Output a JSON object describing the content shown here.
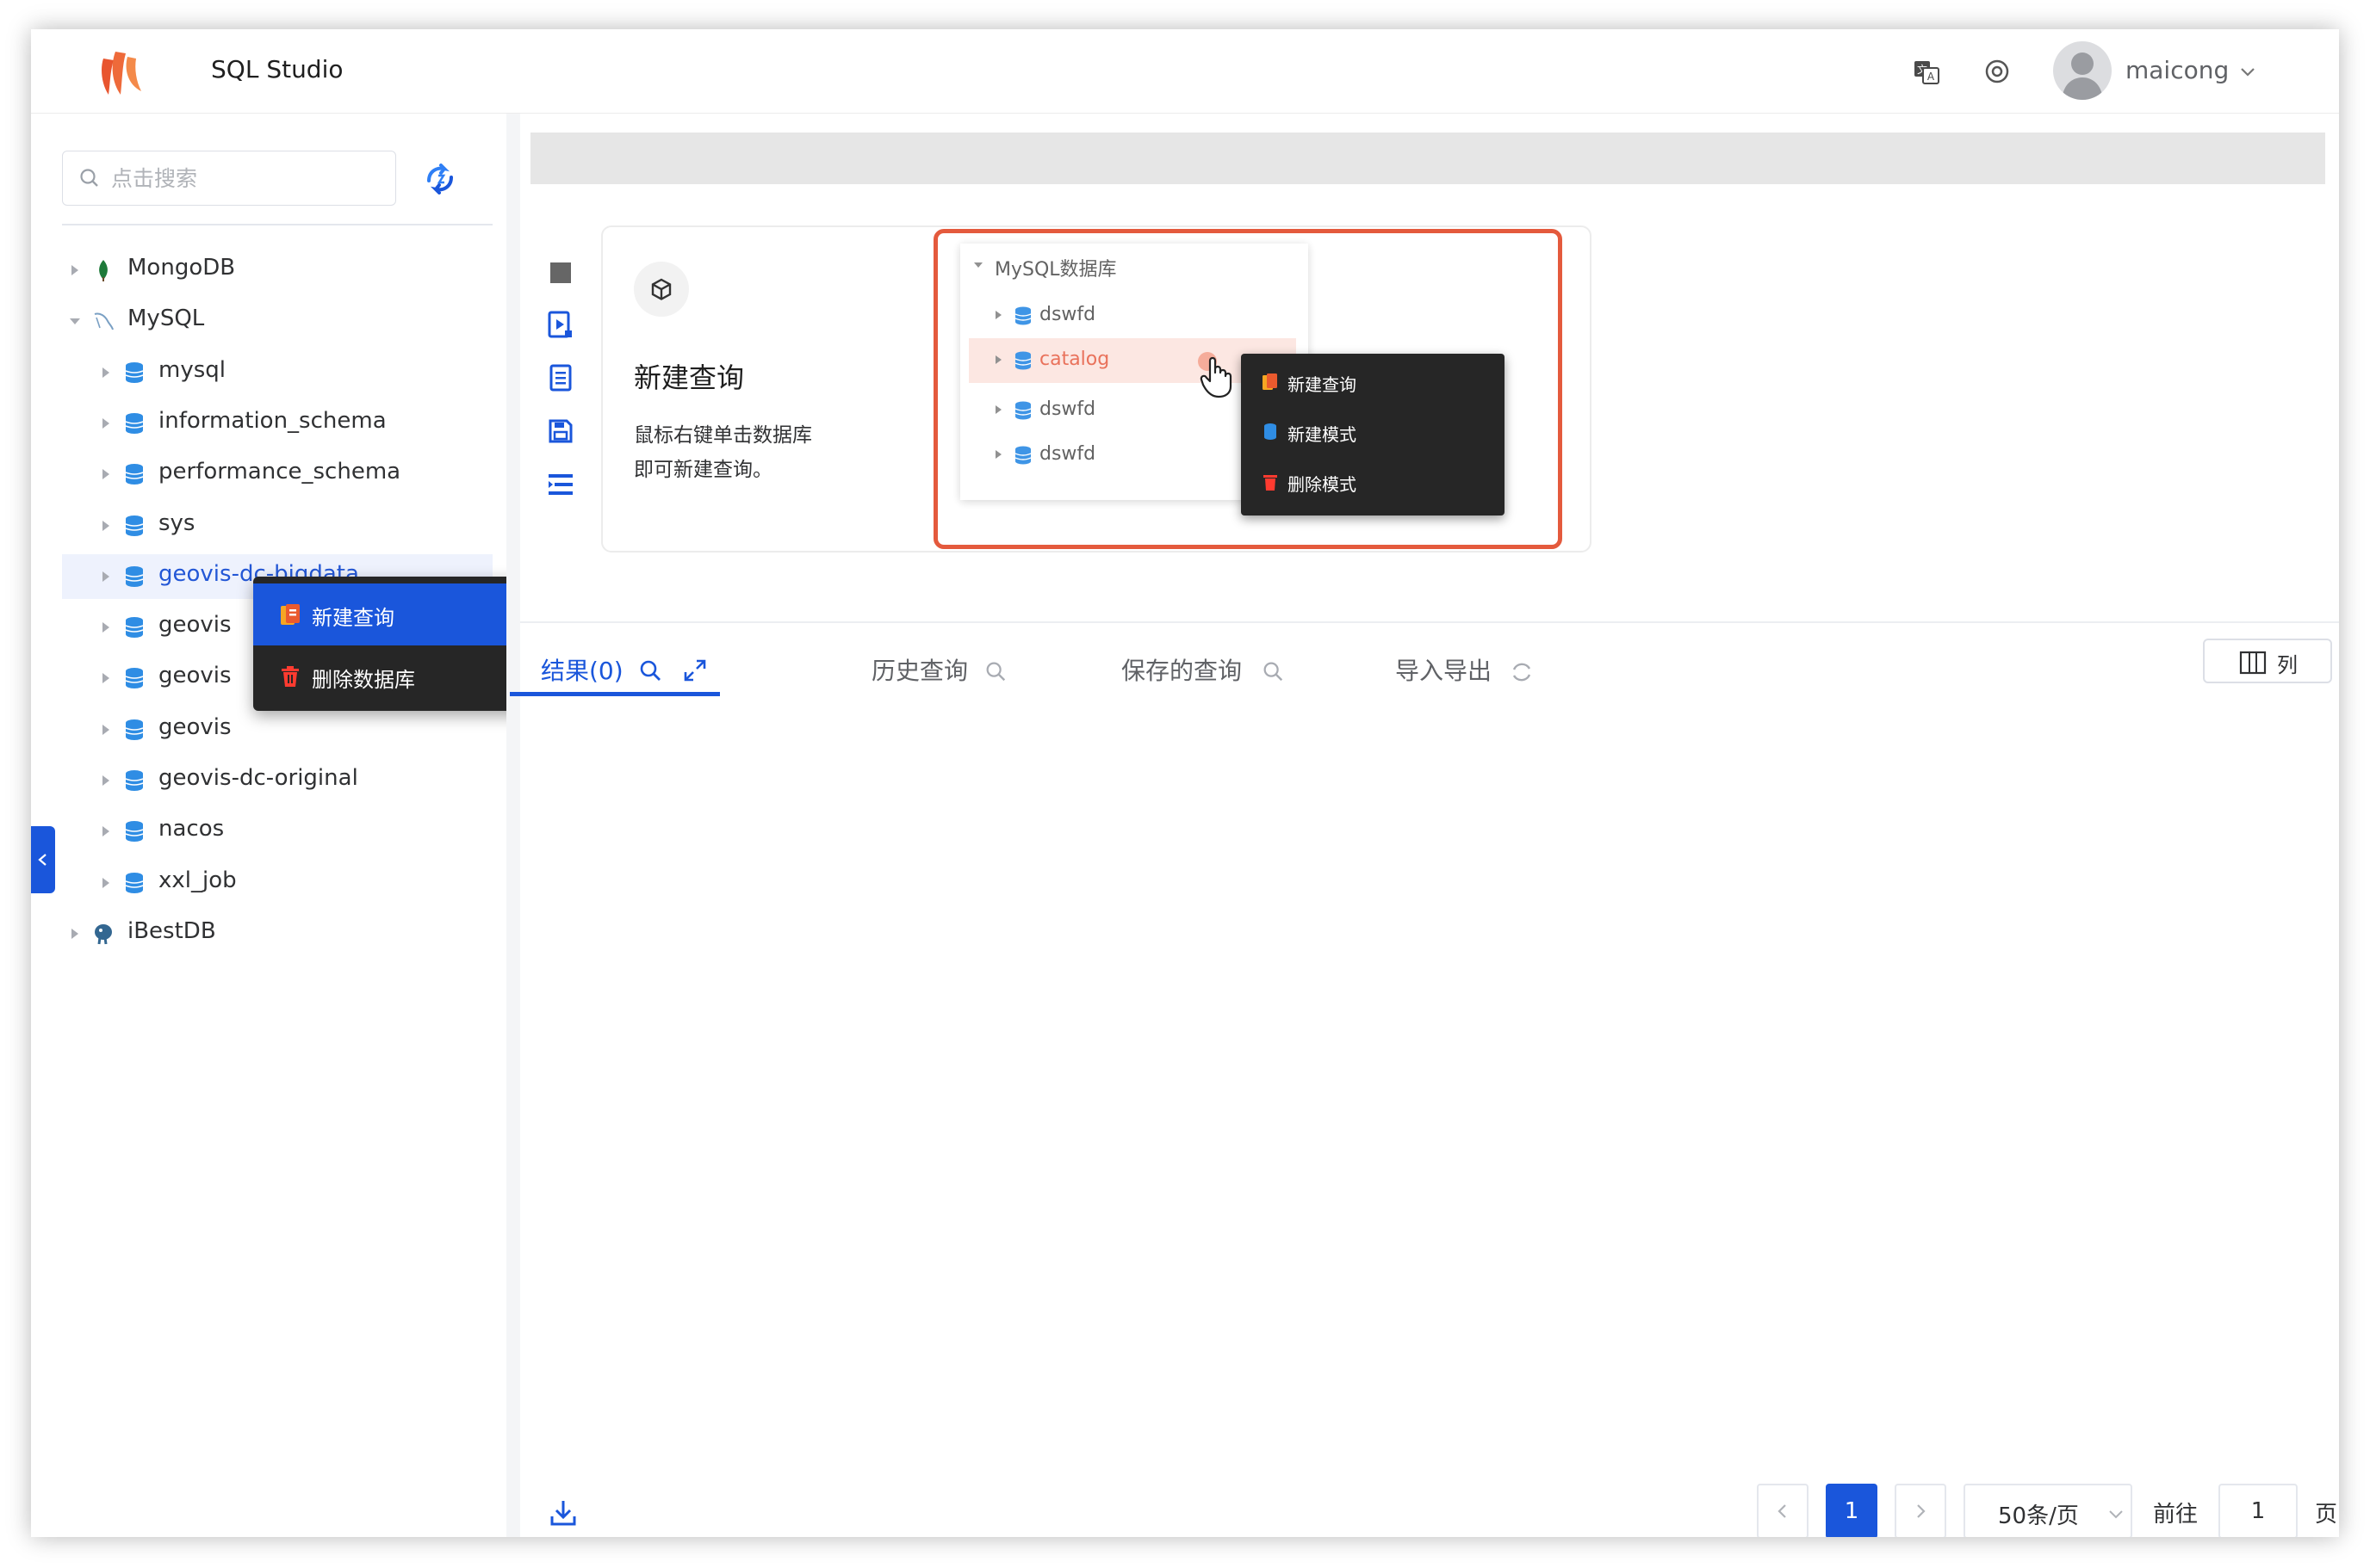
{
  "header": {
    "app_title": "SQL Studio",
    "username": "maicong",
    "icons": [
      "logo",
      "translate-icon",
      "settings-icon",
      "avatar",
      "chevron-down-icon"
    ],
    "brand_color": "#e8552f"
  },
  "sidebar": {
    "search_placeholder": "点击搜索",
    "tree": [
      {
        "label": "MongoDB",
        "icon": "mongodb-leaf-icon",
        "expanded": false
      },
      {
        "label": "MySQL",
        "icon": "mysql-dolphin-icon",
        "expanded": true
      },
      {
        "label": "mysql",
        "icon": "database-icon"
      },
      {
        "label": "information_schema",
        "icon": "database-icon"
      },
      {
        "label": "performance_schema",
        "icon": "database-icon"
      },
      {
        "label": "sys",
        "icon": "database-icon"
      },
      {
        "label": "geovis-dc-bigdata",
        "icon": "database-icon",
        "selected": true
      },
      {
        "label": "geovis",
        "icon": "database-icon"
      },
      {
        "label": "geovis",
        "icon": "database-icon"
      },
      {
        "label": "geovis",
        "icon": "database-icon"
      },
      {
        "label": "geovis-dc-original",
        "icon": "database-icon"
      },
      {
        "label": "nacos",
        "icon": "database-icon"
      },
      {
        "label": "xxl_job",
        "icon": "database-icon"
      },
      {
        "label": "iBestDB",
        "icon": "postgres-elephant-icon",
        "expanded": false
      }
    ]
  },
  "context_menu": {
    "items": [
      {
        "label": "新建查询",
        "icon": "new-query-icon",
        "active": true
      },
      {
        "label": "删除数据库",
        "icon": "trash-icon",
        "active": false
      }
    ],
    "active_color": "#1a56db"
  },
  "help_card": {
    "title": "新建查询",
    "desc_line1": "鼠标右键单击数据库",
    "desc_line2": "即可新建查询。",
    "demo": {
      "root": "MySQL数据库",
      "rows": [
        "dswfd",
        "catalog",
        "dswfd",
        "dswfd"
      ],
      "menu": [
        "新建查询",
        "新建模式",
        "删除模式"
      ],
      "highlight_color": "#e45a3d"
    }
  },
  "tabs": [
    {
      "label": "结果(0)",
      "active": true
    },
    {
      "label": "历史查询",
      "active": false
    },
    {
      "label": "保存的查询",
      "active": false
    },
    {
      "label": "导入导出",
      "active": false
    }
  ],
  "columns_button": "列",
  "pagination": {
    "current_page": "1",
    "page_size": "50条/页",
    "goto_label": "前往",
    "goto_value": "1",
    "suffix": "页"
  }
}
